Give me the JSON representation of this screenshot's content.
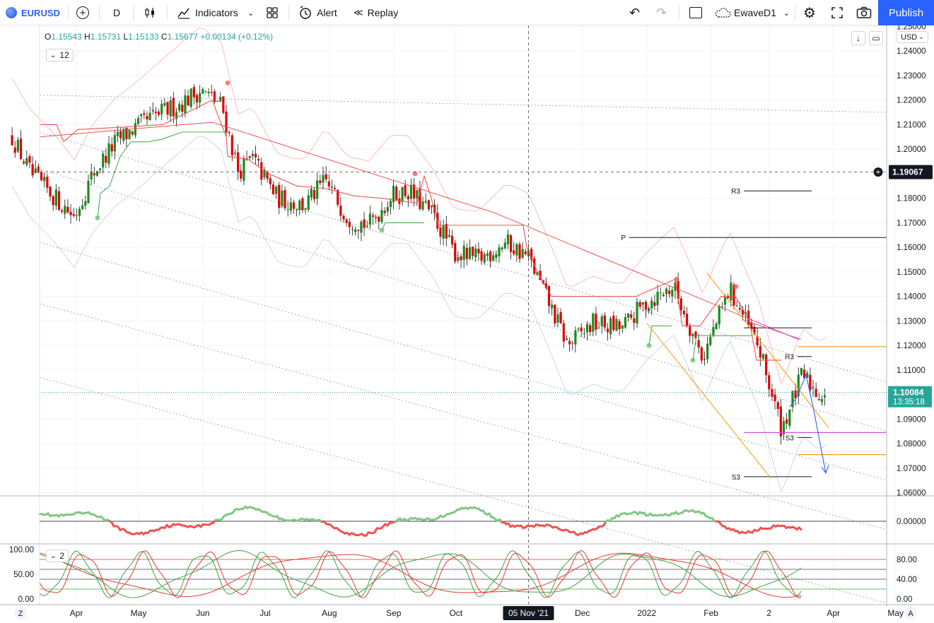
{
  "toolbar": {
    "symbol": "EURUSD",
    "interval": "D",
    "indicators_label": "Indicators",
    "alert_label": "Alert",
    "replay_label": "Replay",
    "layout_name": "EwaveD1",
    "publish_label": "Publish",
    "colors": {
      "brand": "#2962ff"
    }
  },
  "legend": {
    "open_label": "O",
    "open": "1.15543",
    "high_label": "H",
    "high": "1.15731",
    "low_label": "L",
    "low": "1.15133",
    "close_label": "C",
    "close": "1.15677",
    "change": "+0.00134 (+0.12%)",
    "indicator_count": "12",
    "pane2_count": "2"
  },
  "currency": "USD",
  "crosshair": {
    "price": "1.19067",
    "date": "05 Nov '21"
  },
  "last_price": {
    "value": "1.10084",
    "countdown": "13:35:18",
    "color": "#26a69a"
  },
  "bottom_left_button": "Z",
  "bottom_right_button": "A",
  "chart_data": [
    {
      "type": "candlestick",
      "symbol": "EURUSD",
      "interval": "D",
      "y_axis_ticks": [
        "1.25000",
        "1.24000",
        "1.23000",
        "1.22000",
        "1.21000",
        "1.20000",
        "1.19000",
        "1.18000",
        "1.17000",
        "1.16000",
        "1.15000",
        "1.14000",
        "1.13000",
        "1.12000",
        "1.11000",
        "1.10000",
        "1.09000",
        "1.08000",
        "1.07000",
        "1.06000"
      ],
      "x_axis_ticks": [
        "Apr",
        "May",
        "Jun",
        "Jul",
        "Aug",
        "Sep",
        "Oct",
        "Dec",
        "2022",
        "Feb",
        "2",
        "Apr",
        "May"
      ],
      "ylim": [
        1.06,
        1.25
      ],
      "close_path": [
        {
          "x": "2021-03-01",
          "close": 1.205
        },
        {
          "x": "2021-03-10",
          "close": 1.19
        },
        {
          "x": "2021-03-22",
          "close": 1.18
        },
        {
          "x": "2021-03-31",
          "close": 1.1725
        },
        {
          "x": "2021-04-09",
          "close": 1.19
        },
        {
          "x": "2021-04-20",
          "close": 1.203
        },
        {
          "x": "2021-04-30",
          "close": 1.209
        },
        {
          "x": "2021-05-10",
          "close": 1.214
        },
        {
          "x": "2021-05-20",
          "close": 1.218
        },
        {
          "x": "2021-05-31",
          "close": 1.224
        },
        {
          "x": "2021-06-10",
          "close": 1.218
        },
        {
          "x": "2021-06-18",
          "close": 1.191
        },
        {
          "x": "2021-06-25",
          "close": 1.196
        },
        {
          "x": "2021-07-07",
          "close": 1.18
        },
        {
          "x": "2021-07-20",
          "close": 1.177
        },
        {
          "x": "2021-07-30",
          "close": 1.187
        },
        {
          "x": "2021-08-10",
          "close": 1.172
        },
        {
          "x": "2021-08-20",
          "close": 1.169
        },
        {
          "x": "2021-08-31",
          "close": 1.181
        },
        {
          "x": "2021-09-08",
          "close": 1.183
        },
        {
          "x": "2021-09-20",
          "close": 1.173
        },
        {
          "x": "2021-09-30",
          "close": 1.158
        },
        {
          "x": "2021-10-12",
          "close": 1.155
        },
        {
          "x": "2021-10-25",
          "close": 1.162
        },
        {
          "x": "2021-11-05",
          "close": 1.156
        },
        {
          "x": "2021-11-15",
          "close": 1.137
        },
        {
          "x": "2021-11-24",
          "close": 1.12
        },
        {
          "x": "2021-12-06",
          "close": 1.129
        },
        {
          "x": "2021-12-20",
          "close": 1.127
        },
        {
          "x": "2021-12-31",
          "close": 1.137
        },
        {
          "x": "2022-01-14",
          "close": 1.144
        },
        {
          "x": "2022-01-28",
          "close": 1.115
        },
        {
          "x": "2022-02-10",
          "close": 1.143
        },
        {
          "x": "2022-02-24",
          "close": 1.119
        },
        {
          "x": "2022-03-07",
          "close": 1.086
        },
        {
          "x": "2022-03-17",
          "close": 1.108
        },
        {
          "x": "2022-03-25",
          "close": 1.1
        },
        {
          "x": "2022-03-29",
          "close": 1.1008
        }
      ],
      "pivot_labels": [
        "R3",
        "P",
        "R3",
        "S3",
        "S3"
      ]
    },
    {
      "type": "line",
      "panel": "oscillator",
      "y_axis_ticks": [
        "0.00000"
      ],
      "zero_line": 0
    },
    {
      "type": "line",
      "panel": "stochastic",
      "left_axis_ticks": [
        "100.00",
        "50.00",
        "0.00"
      ],
      "right_axis_ticks": [
        "80.00",
        "40.00",
        "0.00"
      ],
      "levels": [
        80,
        60,
        40,
        20
      ]
    }
  ]
}
